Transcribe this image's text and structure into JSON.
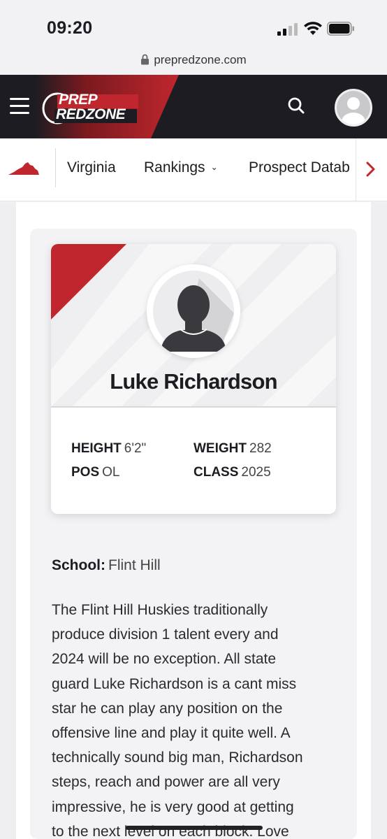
{
  "status_bar": {
    "time": "09:20"
  },
  "browser": {
    "url": "prepredzone.com"
  },
  "header": {
    "logo_line1": "PREP",
    "logo_line2": "REDZONE",
    "brand_color": "#c0262d"
  },
  "subnav": {
    "items": [
      {
        "label": "Virginia"
      },
      {
        "label": "Rankings"
      },
      {
        "label": "Prospect Datab"
      }
    ]
  },
  "player": {
    "name": "Luke Richardson",
    "stats": {
      "height_label": "HEIGHT",
      "height_value": "6'2\"",
      "weight_label": "WEIGHT",
      "weight_value": "282",
      "pos_label": "POS",
      "pos_value": "OL",
      "class_label": "CLASS",
      "class_value": "2025"
    }
  },
  "profile": {
    "school_label": "School:",
    "school_value": "Flint Hill",
    "bio_lines": [
      "The Flint Hill Huskies traditionally",
      "produce division 1 talent every and",
      "2024 will be no exception. All state",
      "guard Luke Richardson is a cant miss",
      "star he can play any position on the",
      "offensive line and play it quite well. A",
      "technically sound big man, Richardson",
      "steps, reach and power are all very",
      "impressive, he is very good at getting",
      "to the next level on each block. Love"
    ]
  }
}
